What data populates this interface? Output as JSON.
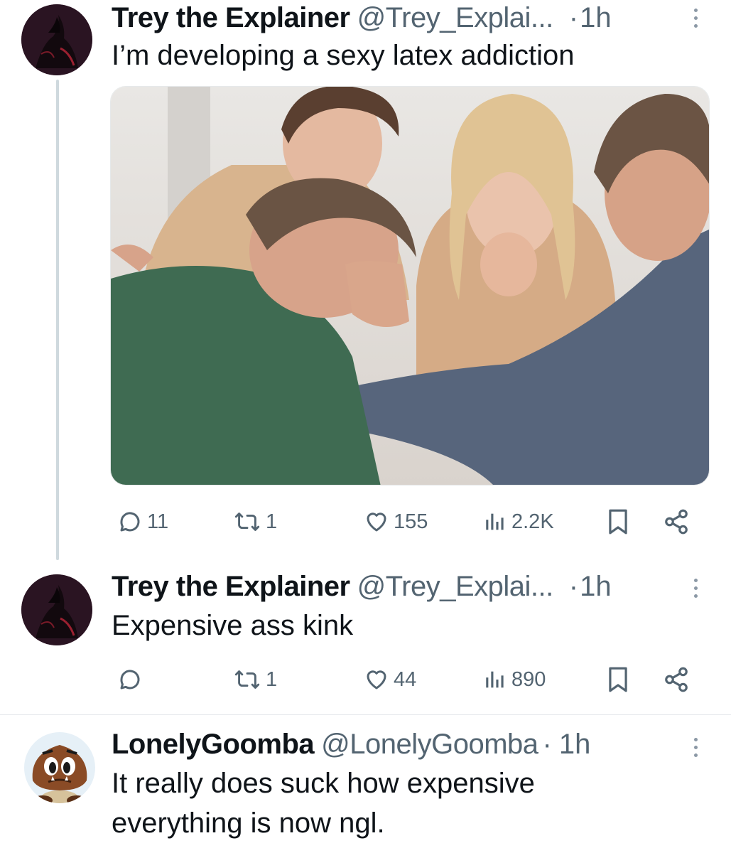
{
  "tweets": [
    {
      "author_name": "Trey the Explainer",
      "handle": "@Trey_Explai...",
      "separator": "·",
      "time": "1h",
      "text": "I’m developing a sexy latex addiction",
      "has_media": true,
      "media_icon": "group-support-photo",
      "avatar_icon": "dark-figure-avatar",
      "stats": {
        "replies": "11",
        "retweets": "1",
        "likes": "155",
        "views": "2.2K"
      }
    },
    {
      "author_name": "Trey the Explainer",
      "handle": "@Trey_Explai...",
      "separator": "·",
      "time": "1h",
      "text": "Expensive ass kink",
      "avatar_icon": "dark-figure-avatar",
      "stats": {
        "replies": "",
        "retweets": "1",
        "likes": "44",
        "views": "890"
      }
    },
    {
      "author_name": "LonelyGoomba",
      "handle": "@LonelyGoomba",
      "separator": "·",
      "time": "1h",
      "text_lines": [
        "It really does suck how expensive",
        "everything is now ngl."
      ],
      "avatar_icon": "goomba-avatar"
    }
  ],
  "icons": {
    "reply": "reply-icon",
    "retweet": "retweet-icon",
    "like": "heart-icon",
    "views": "views-icon",
    "bookmark": "bookmark-icon",
    "share": "share-icon",
    "more": "more-icon"
  },
  "colors": {
    "text": "#0f1419",
    "secondary": "#536471",
    "thread_line": "#cfd9de"
  }
}
